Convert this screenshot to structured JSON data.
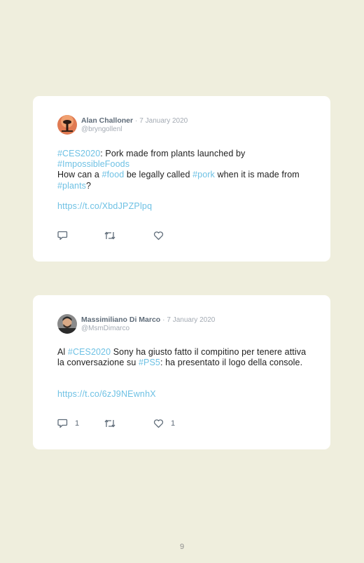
{
  "tweets": [
    {
      "author": "Alan Challoner",
      "separator": "·",
      "date": "7 January 2020",
      "handle": "@bryngollenl",
      "text": {
        "tag1": "#CES2020",
        "p1": ": Pork made from plants launched by",
        "tag2": "#ImpossibleFoods",
        "p2": "How can a ",
        "tag3": "#food",
        "p3": " be legally called ",
        "tag4": "#pork",
        "p4": " when it is made from ",
        "tag5": "#plants",
        "p5": "?"
      },
      "link": "https://t.co/XbdJPZPlpq",
      "reply_count": "",
      "like_count": ""
    },
    {
      "author": "Massimiliano Di Marco",
      "separator": "·",
      "date": "7 January 2020",
      "handle": "@MsmDimarco",
      "text": {
        "p1": "Al ",
        "tag1": "#CES2020",
        "p2": " Sony ha giusto fatto il compitino per tenere attiva la conversazione su ",
        "tag2": "#PS5",
        "p3": ": ha presentato il logo della console."
      },
      "link": "https://t.co/6zJ9NEwnhX",
      "reply_count": "1",
      "like_count": "1"
    }
  ],
  "page_number": "9",
  "icons": {
    "reply": "reply-icon",
    "retweet": "retweet-icon",
    "like": "heart-icon"
  },
  "colors": {
    "background": "#efeedd",
    "card": "#ffffff",
    "hashtag": "#6ec1e4",
    "author": "#5e6b78",
    "meta": "#a3aab3"
  }
}
